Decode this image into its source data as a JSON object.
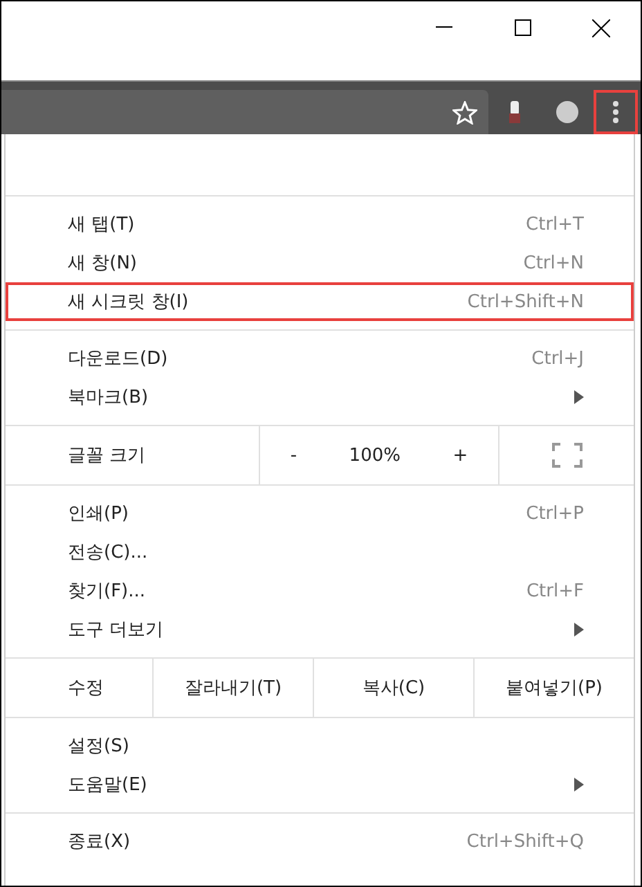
{
  "toolbar": {
    "menu_button_highlighted": true
  },
  "menu": {
    "sections": [
      {
        "kind": "items",
        "items": [
          {
            "label": "새 탭(T)",
            "shortcut": "Ctrl+T",
            "highlighted": false,
            "submenu": false
          },
          {
            "label": "새 창(N)",
            "shortcut": "Ctrl+N",
            "highlighted": false,
            "submenu": false
          },
          {
            "label": "새 시크릿 창(I)",
            "shortcut": "Ctrl+Shift+N",
            "highlighted": true,
            "submenu": false
          }
        ]
      },
      {
        "kind": "items",
        "items": [
          {
            "label": "다운로드(D)",
            "shortcut": "Ctrl+J",
            "highlighted": false,
            "submenu": false
          },
          {
            "label": "북마크(B)",
            "highlighted": false,
            "submenu": true
          }
        ]
      },
      {
        "kind": "zoom",
        "label": "글꼴 크기",
        "minus": "-",
        "value": "100%",
        "plus": "+"
      },
      {
        "kind": "items",
        "items": [
          {
            "label": "인쇄(P)",
            "shortcut": "Ctrl+P",
            "highlighted": false,
            "submenu": false
          },
          {
            "label": "전송(C)...",
            "highlighted": false,
            "submenu": false
          },
          {
            "label": "찾기(F)...",
            "shortcut": "Ctrl+F",
            "highlighted": false,
            "submenu": false
          },
          {
            "label": "도구 더보기",
            "highlighted": false,
            "submenu": true
          }
        ]
      },
      {
        "kind": "edit",
        "label": "수정",
        "buttons": [
          "잘라내기(T)",
          "복사(C)",
          "붙여넣기(P)"
        ]
      },
      {
        "kind": "items",
        "items": [
          {
            "label": "설정(S)",
            "highlighted": false,
            "submenu": false
          },
          {
            "label": "도움말(E)",
            "highlighted": false,
            "submenu": true
          }
        ]
      },
      {
        "kind": "items",
        "items": [
          {
            "label": "종료(X)",
            "shortcut": "Ctrl+Shift+Q",
            "highlighted": false,
            "submenu": false
          }
        ]
      }
    ]
  }
}
